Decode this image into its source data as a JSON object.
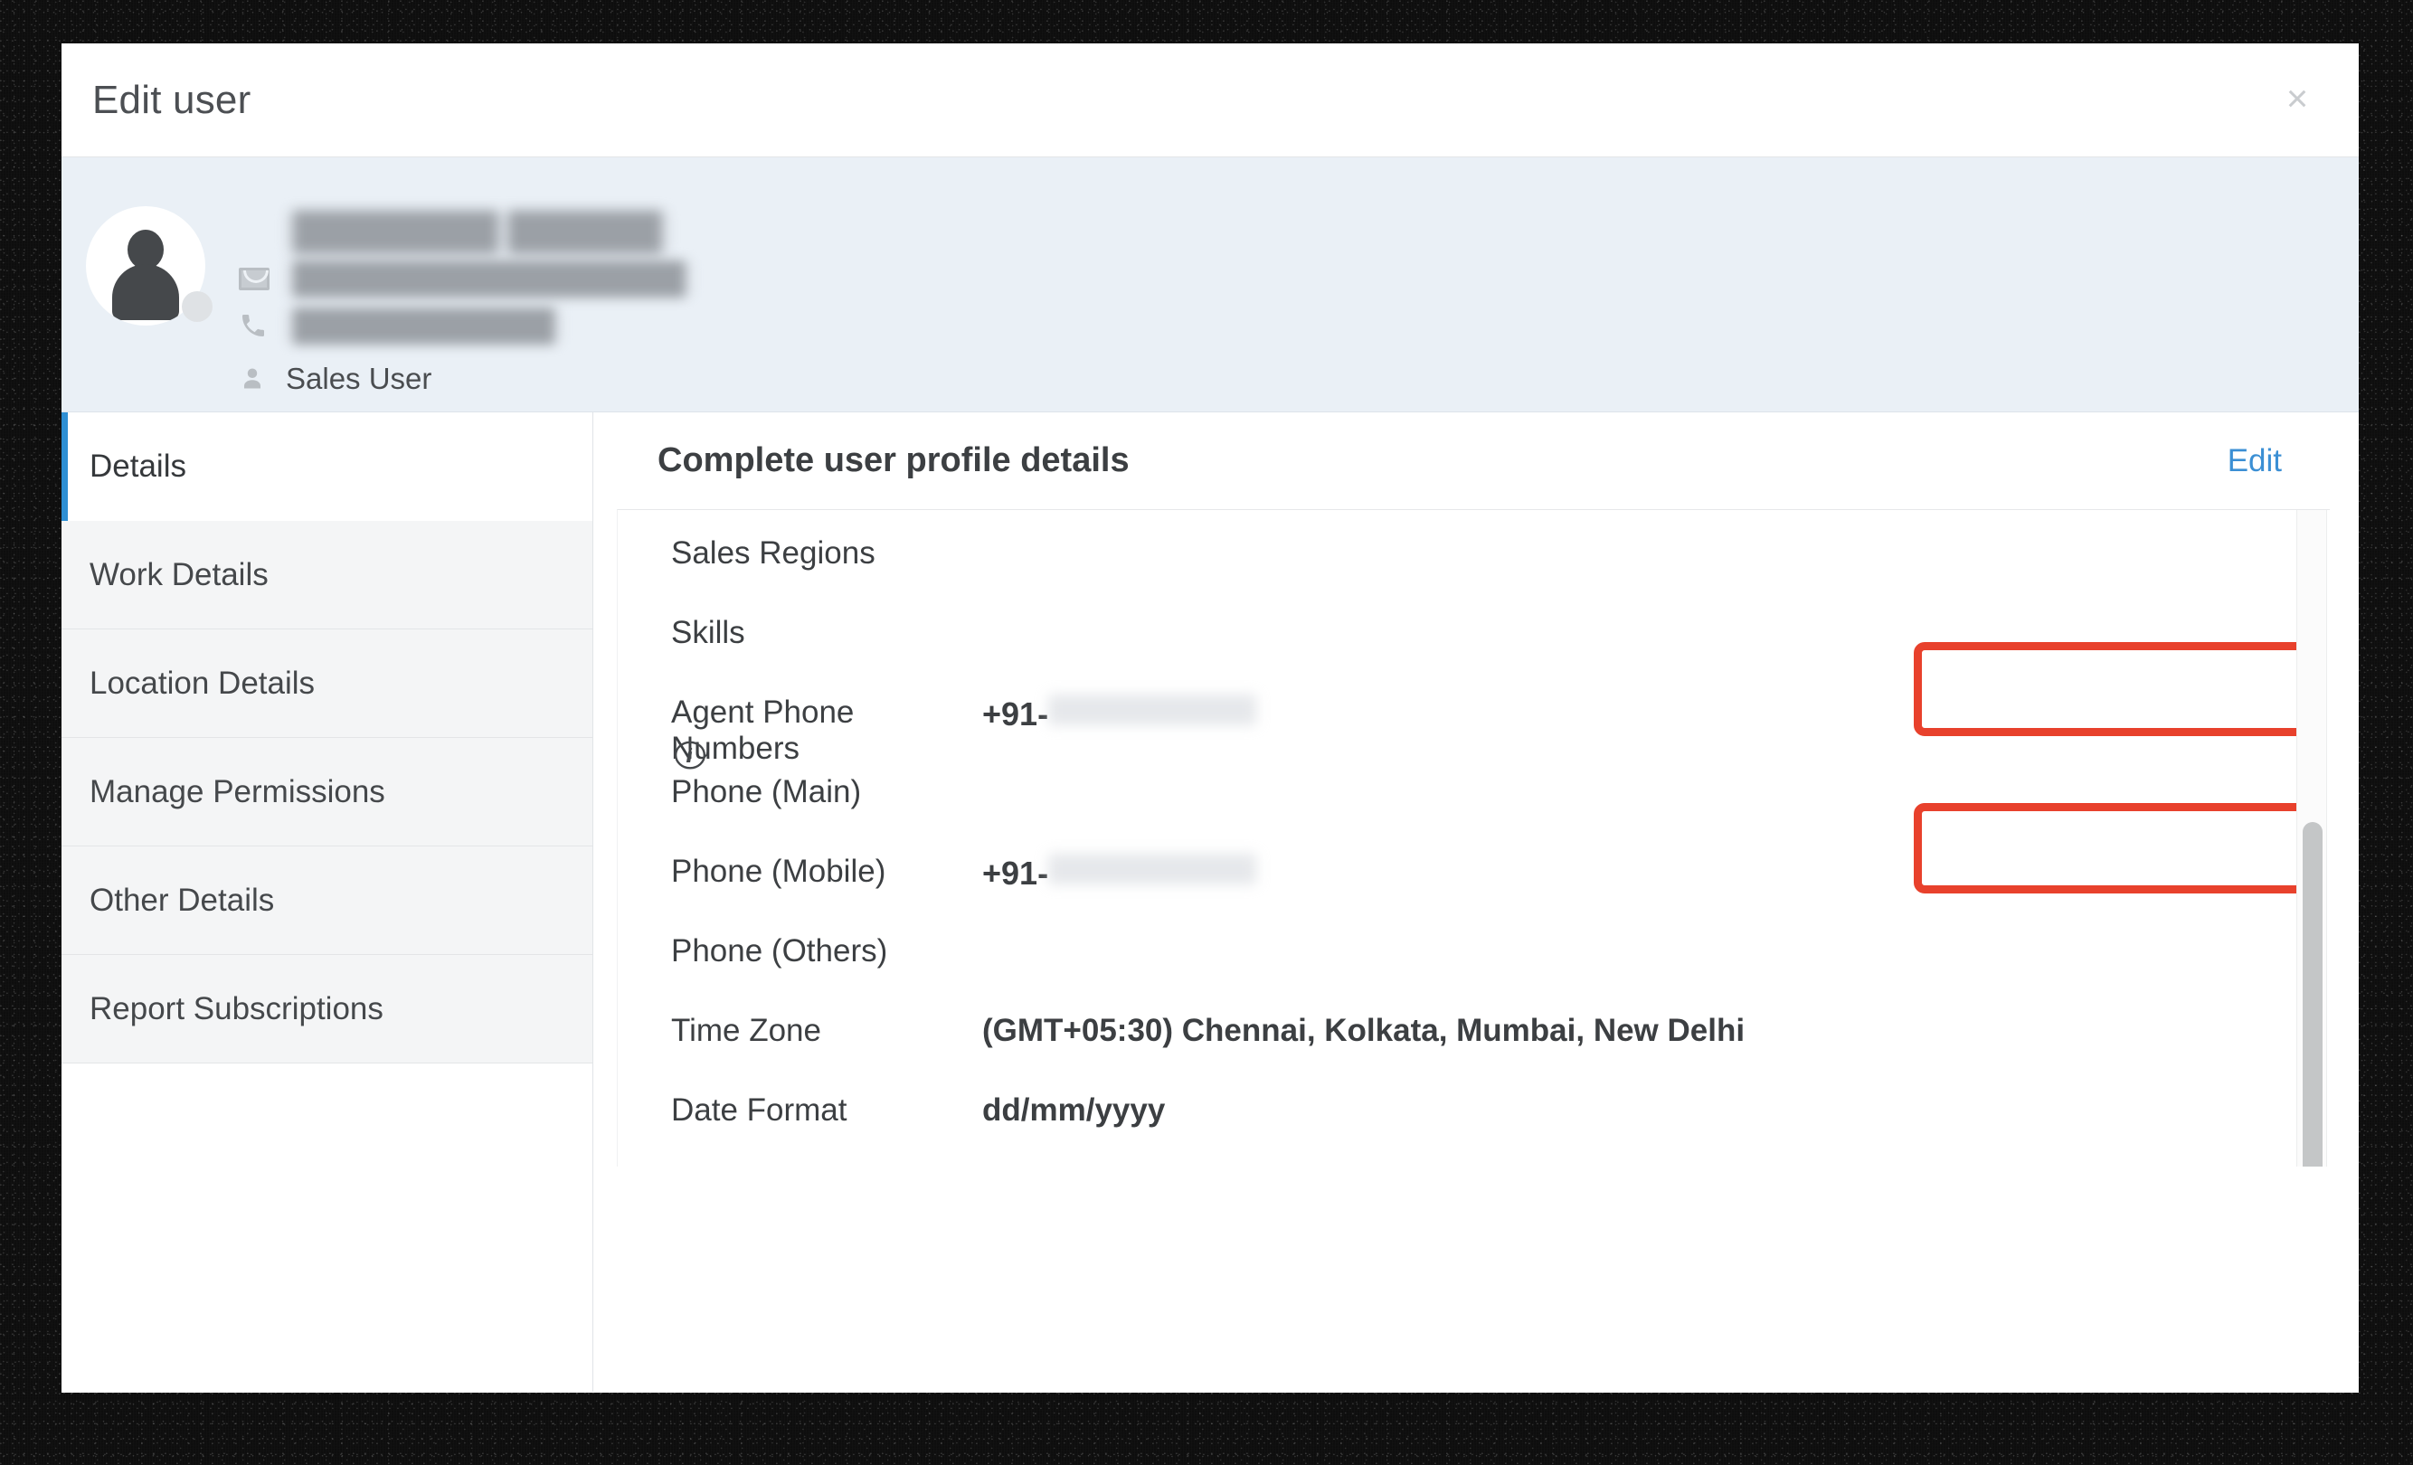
{
  "dialog": {
    "title": "Edit user",
    "close_label": "×"
  },
  "user_header": {
    "avatar_icon": "person-avatar-icon",
    "name_redacted": "████████ ██████",
    "email_icon": "envelope-icon",
    "email_redacted": "██████████████████",
    "phone_icon": "phone-icon",
    "phone_redacted": "████████████",
    "role_icon": "person-icon",
    "role": "Sales User"
  },
  "sidebar": {
    "items": [
      {
        "label": "Details",
        "active": true
      },
      {
        "label": "Work Details",
        "active": false
      },
      {
        "label": "Location Details",
        "active": false
      },
      {
        "label": "Manage Permissions",
        "active": false
      },
      {
        "label": "Other Details",
        "active": false
      },
      {
        "label": "Report Subscriptions",
        "active": false
      }
    ]
  },
  "content": {
    "title": "Complete user profile details",
    "edit_label": "Edit",
    "fields": [
      {
        "label": "Sales Regions",
        "value": ""
      },
      {
        "label": "Skills",
        "value": ""
      },
      {
        "label": "Agent Phone Numbers",
        "value": "",
        "info_icon": "info-icon",
        "phone_prefix": "+91-",
        "highlighted": true
      },
      {
        "label": "Phone (Main)",
        "value": ""
      },
      {
        "label": "Phone (Mobile)",
        "value": "",
        "phone_prefix": "+91-",
        "highlighted": true
      },
      {
        "label": "Phone (Others)",
        "value": ""
      },
      {
        "label": "Time Zone",
        "value": "(GMT+05:30) Chennai, Kolkata, Mumbai, New Delhi"
      },
      {
        "label": "Date Format",
        "value": "dd/mm/yyyy"
      }
    ]
  },
  "colors": {
    "accent_blue": "#2e8fd4",
    "link_blue": "#3b8fd4",
    "highlight_red": "#e8412c",
    "header_bg": "#eaf0f6"
  }
}
